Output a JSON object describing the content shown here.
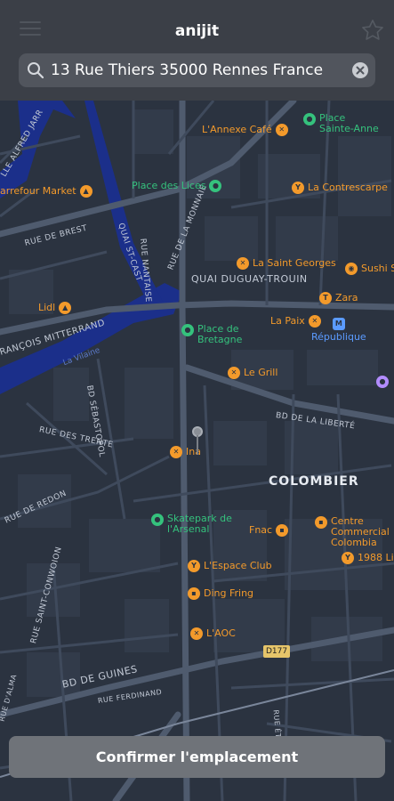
{
  "header": {
    "title": "anijit",
    "menu_icon": "hamburger-menu-icon",
    "favorite_icon": "star-outline-icon"
  },
  "search": {
    "value": "13 Rue Thiers 35000 Rennes France",
    "search_icon": "magnifier-icon",
    "clear_icon": "clear-x-icon"
  },
  "map": {
    "district": "COLOMBIER",
    "river": "La Vilaine",
    "road_shield": "D177",
    "streets": [
      "LLE ALFRED JARR",
      "RUE DE BREST",
      "QUAI ST-CAST",
      "RUE NANTAISE",
      "RUE DE LA MONNAIE",
      "QUAI DUGUAY-TROUIN",
      "RANÇOIS MITTERRAND",
      "BD SÉBASTOPOL",
      "BD DE LA LIBERTÉ",
      "RUE DES TRENTE",
      "RUE DE REDON",
      "RUE SAINT-CONWOION",
      "BD DE GUINES",
      "RUE FERDINAND",
      "RUE D'ALMA",
      "RUE ÉTIENNE"
    ],
    "pois": [
      {
        "label": "L'Annexe Café",
        "type": "orange",
        "icon": "restaurant-icon"
      },
      {
        "label": "Place Sainte-Anne",
        "type": "green",
        "icon": "park-icon"
      },
      {
        "label": "arrefour Market",
        "type": "orange",
        "icon": "shopping-cart-icon"
      },
      {
        "label": "Place des Lices",
        "type": "green",
        "icon": "park-icon"
      },
      {
        "label": "La Contrescarpe",
        "type": "orange",
        "icon": "bar-icon"
      },
      {
        "label": "La Saint Georges",
        "type": "orange",
        "icon": "restaurant-icon"
      },
      {
        "label": "Sushi S",
        "type": "orange",
        "icon": "sushi-icon"
      },
      {
        "label": "Zara",
        "type": "orange",
        "icon": "clothing-icon"
      },
      {
        "label": "Lidl",
        "type": "orange",
        "icon": "shopping-cart-icon"
      },
      {
        "label": "Place de Bretagne",
        "type": "green",
        "icon": "park-icon"
      },
      {
        "label": "La Paix",
        "type": "orange",
        "icon": "restaurant-icon"
      },
      {
        "label": "République",
        "type": "blue",
        "icon": "metro-icon"
      },
      {
        "label": "Le Grill",
        "type": "orange",
        "icon": "restaurant-icon"
      },
      {
        "label": "Ina",
        "type": "orange",
        "icon": "restaurant-icon"
      },
      {
        "label": "Skatepark de l'Arsenal",
        "type": "green",
        "icon": "park-icon"
      },
      {
        "label": "Fnac",
        "type": "orange",
        "icon": "store-icon"
      },
      {
        "label": "Centre Commercial Colombia",
        "type": "orange",
        "icon": "mall-icon"
      },
      {
        "label": "1988 Li",
        "type": "orange",
        "icon": "bar-icon"
      },
      {
        "label": "L'Espace Club",
        "type": "orange",
        "icon": "bar-icon"
      },
      {
        "label": "Ding Fring",
        "type": "orange",
        "icon": "store-icon"
      },
      {
        "label": "L'AOC",
        "type": "orange",
        "icon": "restaurant-icon"
      }
    ]
  },
  "confirm_button": {
    "label": "Confirmer l'emplacement"
  },
  "colors": {
    "map_bg": "#2b3340",
    "road": "#4a5568",
    "river": "#1b2f8a",
    "poi_orange": "#f39a2b",
    "poi_green": "#35c27d",
    "poi_blue": "#5b9bff",
    "header_bg": "#3b3f47",
    "button_bg": "#6f7379"
  }
}
